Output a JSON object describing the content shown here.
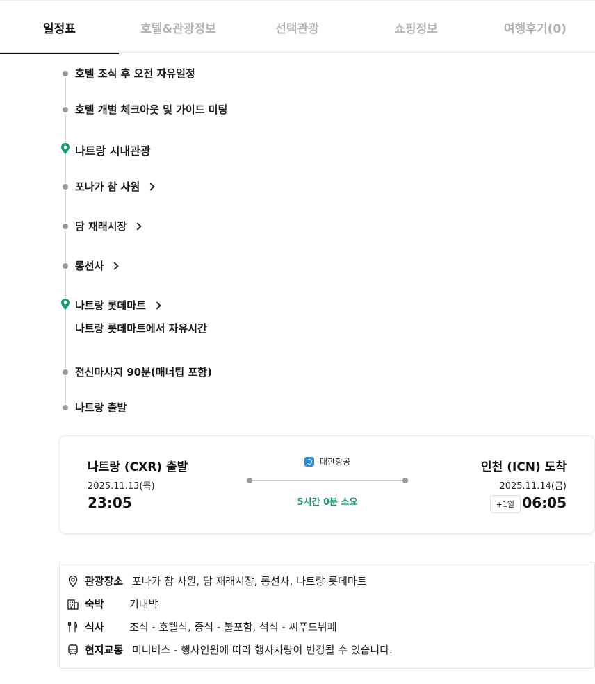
{
  "tabs": [
    {
      "label": "일정표",
      "active": true
    },
    {
      "label": "호텔&관광정보",
      "active": false
    },
    {
      "label": "선택관광",
      "active": false
    },
    {
      "label": "쇼핑정보",
      "active": false
    },
    {
      "label": "여행후기(0)",
      "active": false
    }
  ],
  "timeline": {
    "items": [
      {
        "label": "호텔 조식 후 오전 자유일정",
        "type": "dot"
      },
      {
        "label": "호텔 개별 체크아웃 및 가이드 미팅",
        "type": "dot"
      },
      {
        "label": "나트랑 시내관광",
        "type": "pin"
      },
      {
        "label": "포나가 참 사원",
        "type": "dot",
        "link": true
      },
      {
        "label": "담 재래시장",
        "type": "dot",
        "link": true
      },
      {
        "label": "롱선사",
        "type": "dot",
        "link": true
      },
      {
        "label": "나트랑 롯데마트",
        "type": "pin",
        "link": true
      },
      {
        "label": "나트랑 롯데마트에서 자유시간",
        "type": "sub"
      },
      {
        "label": "전신마사지 90분(매너팁 포함)",
        "type": "dot"
      },
      {
        "label": "나트랑 출발",
        "type": "dot"
      }
    ]
  },
  "flight": {
    "departure": {
      "title": "나트랑 (CXR) 출발",
      "date": "2025.11.13(목)",
      "time": "23:05"
    },
    "arrival": {
      "title": "인천 (ICN) 도착",
      "date": "2025.11.14(금)",
      "time": "06:05",
      "day_offset": "+1일"
    },
    "airline": "대한항공",
    "duration": "5시간 0분 소요",
    "duration_color": "#1a9a74"
  },
  "info": {
    "sightseeing": {
      "label": "관광장소",
      "value": "포나가 참 사원, 담 재래시장, 롱선사, 나트랑 롯데마트",
      "icon": "map-pin-icon"
    },
    "lodging": {
      "label": "숙박",
      "value": "기내박",
      "icon": "building-icon"
    },
    "meals": {
      "label": "식사",
      "value": "조식 - 호텔식, 중식 - 불포함, 석식 - 씨푸드뷔페",
      "icon": "fork-knife-icon"
    },
    "transport": {
      "label": "현지교통",
      "value": "미니버스 - 행사인원에 따라 행사차량이 변경될 수 있습니다.",
      "icon": "bus-icon"
    }
  },
  "colors": {
    "pin": "#1a9a74",
    "dot": "#9a9a9a",
    "accent": "#1a9a74"
  }
}
